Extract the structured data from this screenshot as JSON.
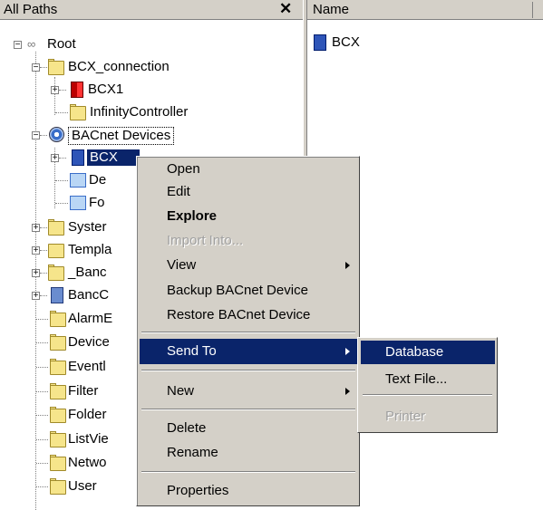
{
  "left_pane": {
    "header_title": "All Paths",
    "close_glyph": "✕",
    "tree": [
      {
        "label": "Root",
        "icon": "root-network-icon"
      },
      {
        "label": "BCX_connection",
        "icon": "folder-icon"
      },
      {
        "label": "BCX1",
        "icon": "controller-red-icon"
      },
      {
        "label": "InfinityController",
        "icon": "folder-icon"
      },
      {
        "label": "BACnet Devices",
        "icon": "globe-network-icon"
      },
      {
        "label": "BCX",
        "icon": "bacnet-device-icon"
      },
      {
        "label": "De",
        "icon": "device-folder-icon"
      },
      {
        "label": "Fo",
        "icon": "device-folder-icon"
      },
      {
        "label": "Syster",
        "icon": "folder-icon"
      },
      {
        "label": "Templa",
        "icon": "template-folder-icon"
      },
      {
        "label": "_Banc",
        "icon": "folder-icon"
      },
      {
        "label": "BancC",
        "icon": "bank-device-icon"
      },
      {
        "label": "AlarmE",
        "icon": "folder-icon"
      },
      {
        "label": "Device",
        "icon": "folder-icon"
      },
      {
        "label": "Eventl",
        "icon": "folder-icon"
      },
      {
        "label": "Filter",
        "icon": "folder-icon"
      },
      {
        "label": "Folder",
        "icon": "folder-icon"
      },
      {
        "label": "ListVie",
        "icon": "folder-icon"
      },
      {
        "label": "Netwo",
        "icon": "folder-icon"
      },
      {
        "label": "User",
        "icon": "folder-icon"
      }
    ]
  },
  "right_pane": {
    "column_header": "Name",
    "items": [
      {
        "label": "BCX",
        "icon": "bacnet-device-icon"
      }
    ]
  },
  "context_menu": {
    "items": [
      {
        "label": "Open"
      },
      {
        "label": "Edit"
      },
      {
        "label": "Explore"
      },
      {
        "label": "Import Into..."
      },
      {
        "label": "View"
      },
      {
        "label": "Backup BACnet Device"
      },
      {
        "label": "Restore BACnet Device"
      },
      {
        "label": "Send To"
      },
      {
        "label": "New"
      },
      {
        "label": "Delete"
      },
      {
        "label": "Rename"
      },
      {
        "label": "Properties"
      }
    ]
  },
  "send_to_submenu": {
    "items": [
      {
        "label": "Database"
      },
      {
        "label": "Text File..."
      },
      {
        "label": "Printer"
      }
    ]
  },
  "colors": {
    "highlight": "#0a246a",
    "face": "#d4d0c8",
    "folder": "#f6e58b"
  }
}
